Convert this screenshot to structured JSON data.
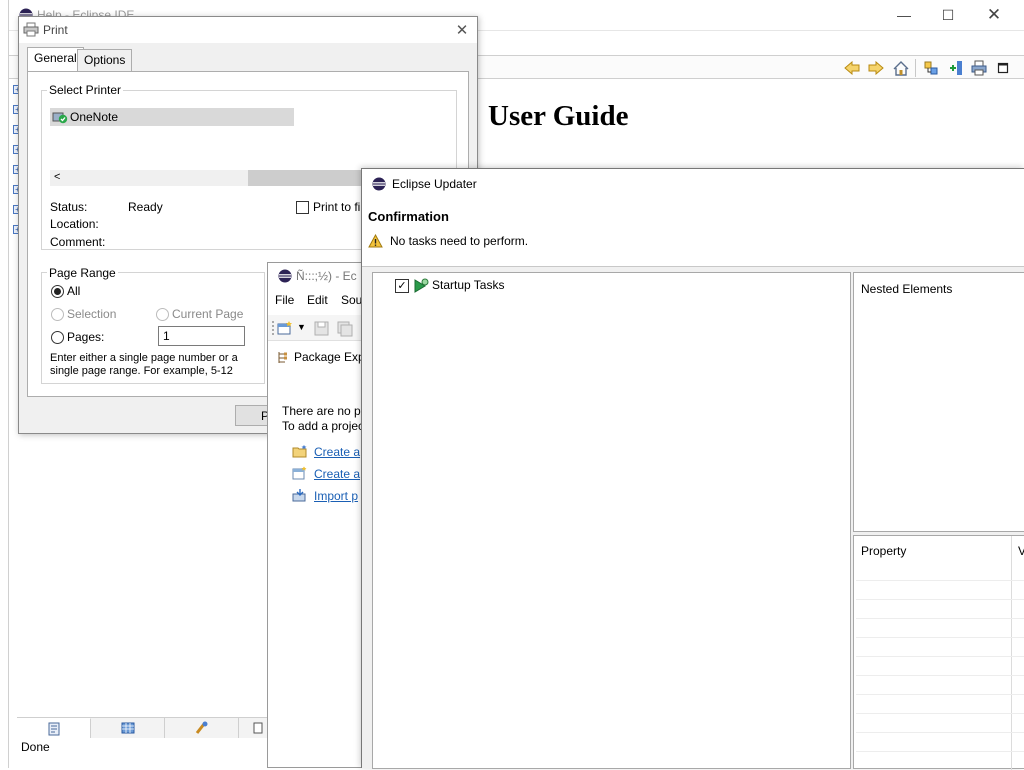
{
  "help": {
    "title": "Help - Eclipse IDE",
    "heading": "User Guide",
    "status": "Done"
  },
  "print": {
    "title": "Print",
    "tabs": [
      "General",
      "Options"
    ],
    "select_printer_label": "Select Printer",
    "printer": "OneNote",
    "status_label": "Status:",
    "status_value": "Ready",
    "location_label": "Location:",
    "comment_label": "Comment:",
    "print_to_file": "Print to file",
    "page_range_label": "Page Range",
    "all_label": "All",
    "selection_label": "Selection",
    "current_page_label": "Current Page",
    "pages_label": "Pages:",
    "pages_value": "1",
    "hint": "Enter either a single page number or a single page range.  For example, 5-12",
    "print_button": "P"
  },
  "ide": {
    "title": "Ñ:::;½) - Ec",
    "menu": [
      "File",
      "Edit",
      "Sou"
    ],
    "view_tab": "Package Expl",
    "empty_line1": "There are no pr",
    "empty_line2": "To add a projec",
    "links": [
      "Create a",
      "Create a",
      "Import p"
    ]
  },
  "updater": {
    "title": "Eclipse Updater",
    "heading": "Confirmation",
    "message": "No tasks need to perform.",
    "tree_item": "Startup Tasks",
    "nested_label": "Nested Elements",
    "property_label": "Property",
    "value_label": "V"
  }
}
